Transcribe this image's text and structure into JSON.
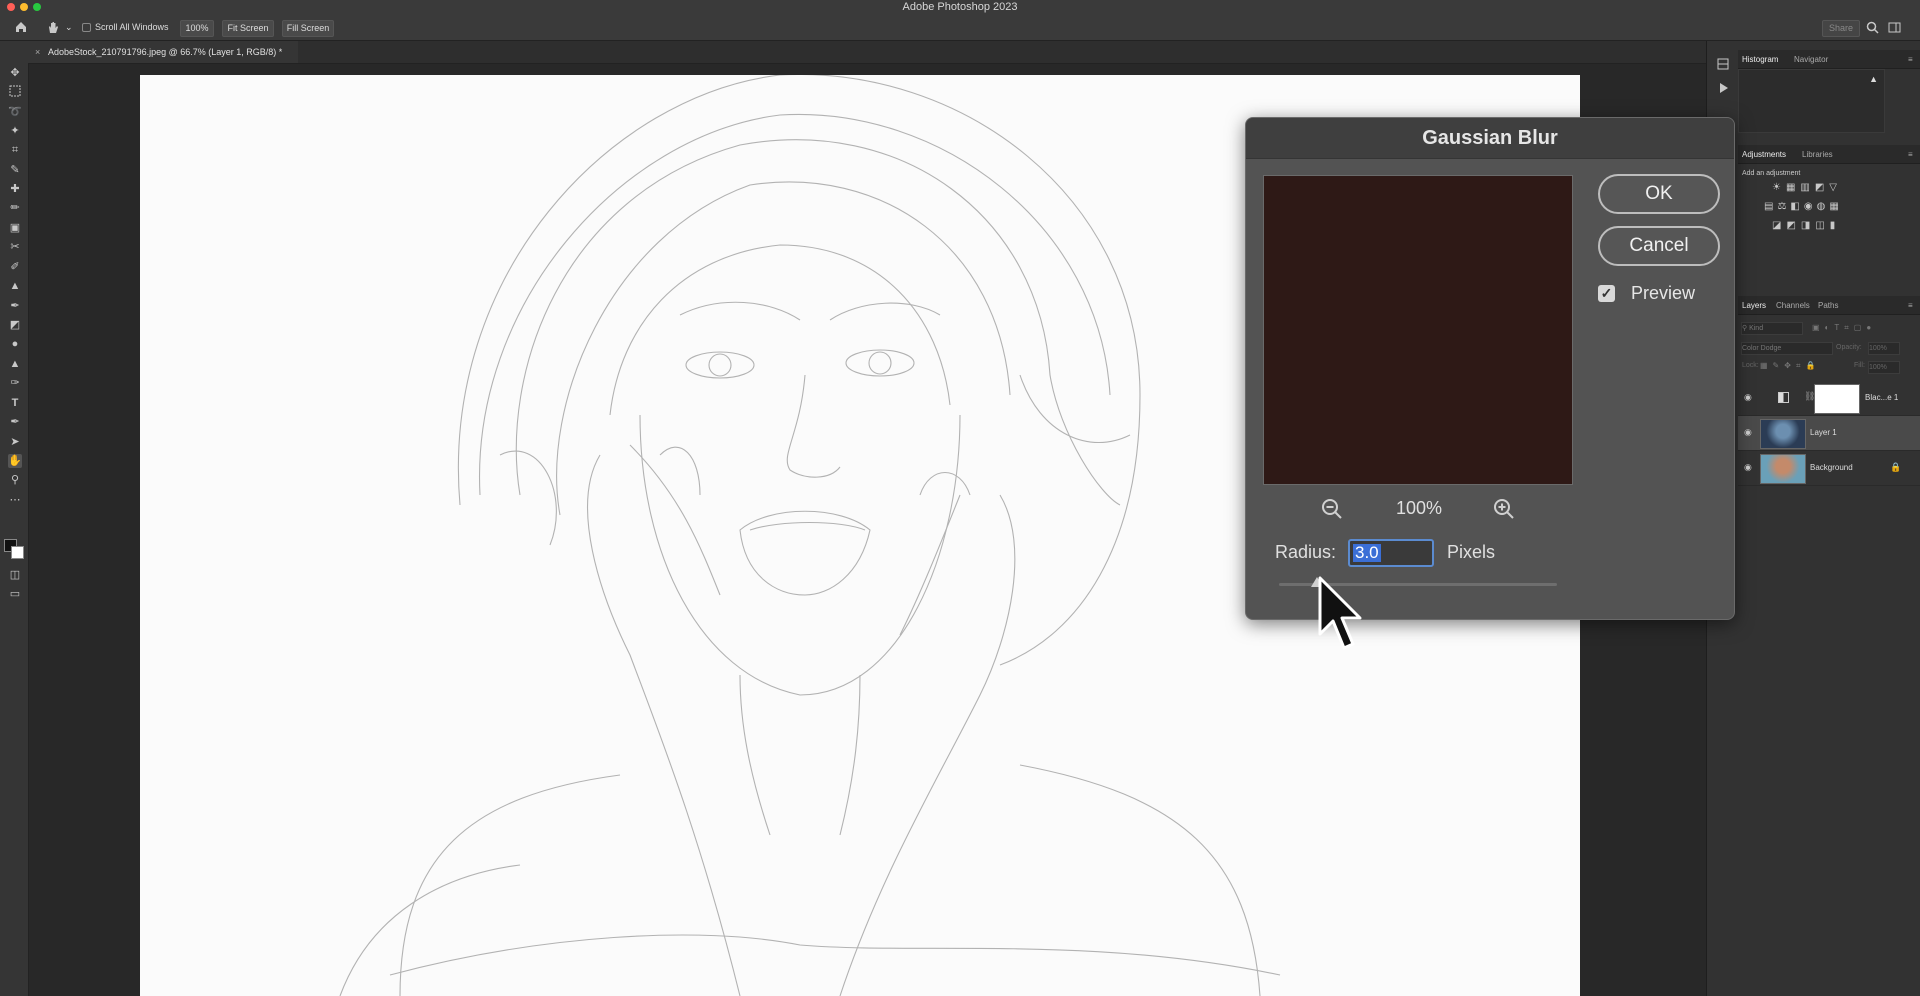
{
  "app": {
    "title": "Adobe Photoshop 2023"
  },
  "options_bar": {
    "scroll_all_windows": "Scroll All Windows",
    "zoom_value": "100%",
    "fit_screen": "Fit Screen",
    "fill_screen": "Fill Screen",
    "share": "Share"
  },
  "document": {
    "tab_label": "AdobeStock_210791796.jpeg @ 66.7% (Layer 1, RGB/8) *"
  },
  "panels": {
    "top_tabs": [
      "Histogram",
      "Navigator"
    ],
    "mid_tabs": [
      "Adjustments",
      "Libraries"
    ],
    "add_adjustment": "Add an adjustment",
    "layers_tabs": [
      "Layers",
      "Channels",
      "Paths"
    ],
    "kind_placeholder": "Kind",
    "blend_mode": "Color Dodge",
    "opacity_label": "Opacity:",
    "opacity_value": "100%",
    "lock_label": "Lock:",
    "fill_label": "Fill:",
    "fill_value": "100%",
    "layers": [
      {
        "name": "Blac...e 1"
      },
      {
        "name": "Layer 1"
      },
      {
        "name": "Background"
      }
    ]
  },
  "dialog": {
    "title": "Gaussian Blur",
    "ok_label": "OK",
    "cancel_label": "Cancel",
    "preview_label": "Preview",
    "preview_checked": true,
    "zoom_value": "100%",
    "radius_label": "Radius:",
    "radius_value": "3.0",
    "radius_unit": "Pixels",
    "preview_color": "#2e1916"
  },
  "colors": {
    "accent": "#3b6fd6",
    "canvas": "#fbfbfb",
    "ui_bg": "#282828"
  }
}
